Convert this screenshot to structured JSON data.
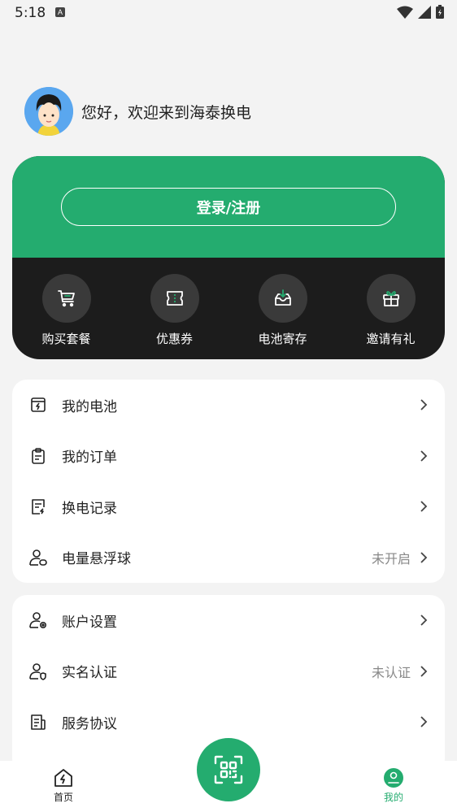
{
  "status_bar": {
    "time": "5:18",
    "a_badge": "A"
  },
  "header": {
    "greeting": "您好，欢迎来到海泰换电"
  },
  "card": {
    "login_label": "登录/注册",
    "quick_actions": [
      {
        "label": "购买套餐",
        "icon": "cart-icon"
      },
      {
        "label": "优惠券",
        "icon": "ticket-icon"
      },
      {
        "label": "电池寄存",
        "icon": "inbox-download-icon"
      },
      {
        "label": "邀请有礼",
        "icon": "gift-icon"
      }
    ]
  },
  "menu1": [
    {
      "label": "我的电池",
      "value": "",
      "icon": "battery-icon"
    },
    {
      "label": "我的订单",
      "value": "",
      "icon": "clipboard-icon"
    },
    {
      "label": "换电记录",
      "value": "",
      "icon": "record-icon"
    },
    {
      "label": "电量悬浮球",
      "value": "未开启",
      "icon": "user-float-icon"
    }
  ],
  "menu2": [
    {
      "label": "账户设置",
      "value": "",
      "icon": "user-settings-icon"
    },
    {
      "label": "实名认证",
      "value": "未认证",
      "icon": "user-shield-icon"
    },
    {
      "label": "服务协议",
      "value": "",
      "icon": "document-icon"
    }
  ],
  "tabbar": {
    "home_label": "首页",
    "mine_label": "我的",
    "active_color": "#24ac6f"
  },
  "colors": {
    "brand": "#24ac6f",
    "dark_card": "#1c1c1c"
  }
}
